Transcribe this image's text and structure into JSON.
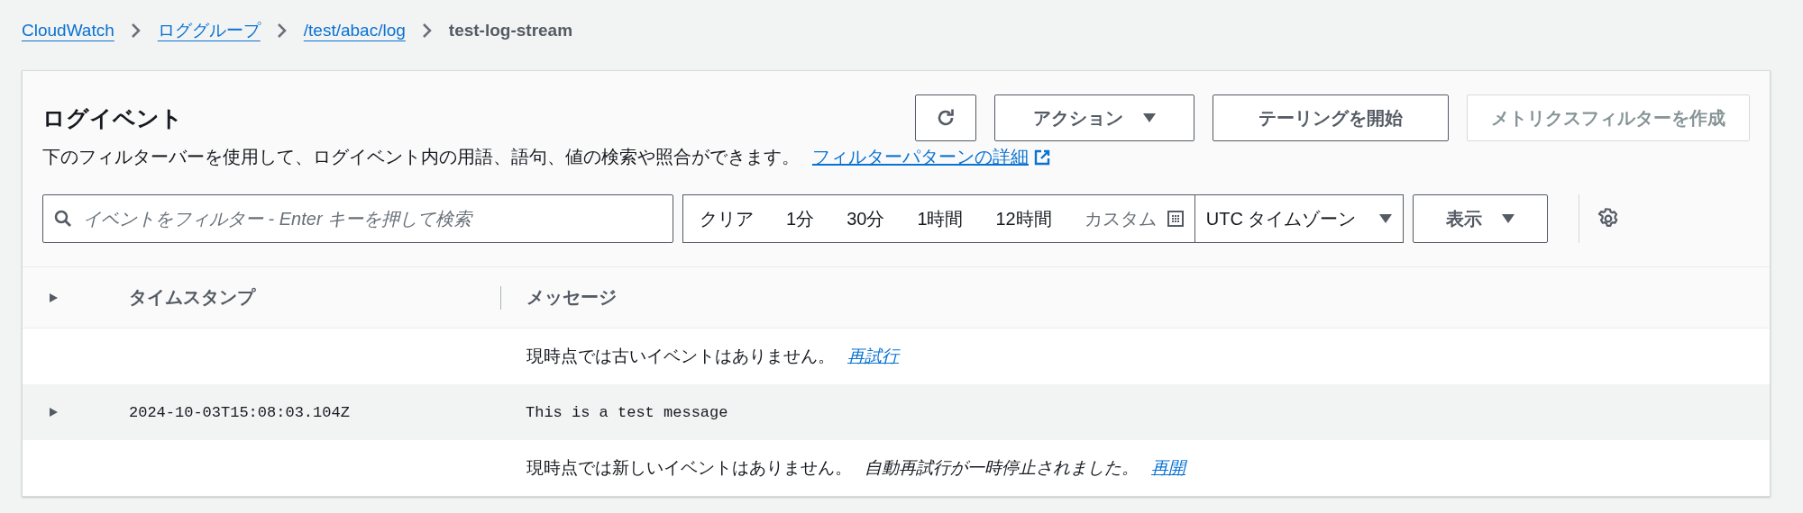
{
  "breadcrumbs": [
    {
      "label": "CloudWatch",
      "kind": "link"
    },
    {
      "label": "ロググループ",
      "kind": "link"
    },
    {
      "label": "/test/abac/log",
      "kind": "link"
    },
    {
      "label": "test-log-stream",
      "kind": "current"
    }
  ],
  "panel": {
    "title": "ログイベント",
    "buttons": [
      {
        "kind": "refresh",
        "disabled": false
      },
      {
        "kind": "dropdown",
        "label": "アクション",
        "disabled": false
      },
      {
        "kind": "plain",
        "label": "テーリングを開始",
        "disabled": false
      },
      {
        "kind": "plain",
        "label": "メトリクスフィルターを作成",
        "disabled": true
      }
    ],
    "description": "下のフィルターバーを使用して、ログイベント内の用語、語句、値の検索や照合ができます。",
    "description_link": "フィルターパターンの詳細"
  },
  "filter_bar": {
    "search": {
      "placeholder": "イベントをフィルター - Enter キーを押して検索"
    },
    "time_range": [
      {
        "label": "クリア"
      },
      {
        "label": "1分"
      },
      {
        "label": "30分"
      },
      {
        "label": "1時間"
      },
      {
        "label": "12時間"
      }
    ],
    "custom": "カスタム",
    "timezone": "UTC タイムゾーン",
    "display": "表示"
  },
  "table": {
    "columns": [
      "タイムスタンプ",
      "メッセージ"
    ],
    "rows": [
      {
        "kind": "notice",
        "text": "現時点では古いイベントはありません。",
        "link": "再試行"
      },
      {
        "kind": "event",
        "timestamp": "2024-10-03T15:08:03.104Z",
        "message": "This is a test message",
        "expanded": false
      },
      {
        "kind": "notice",
        "text": "現時点では新しいイベントはありません。",
        "note": "自動再試行が一時停止されました。",
        "link": "再開"
      }
    ]
  }
}
